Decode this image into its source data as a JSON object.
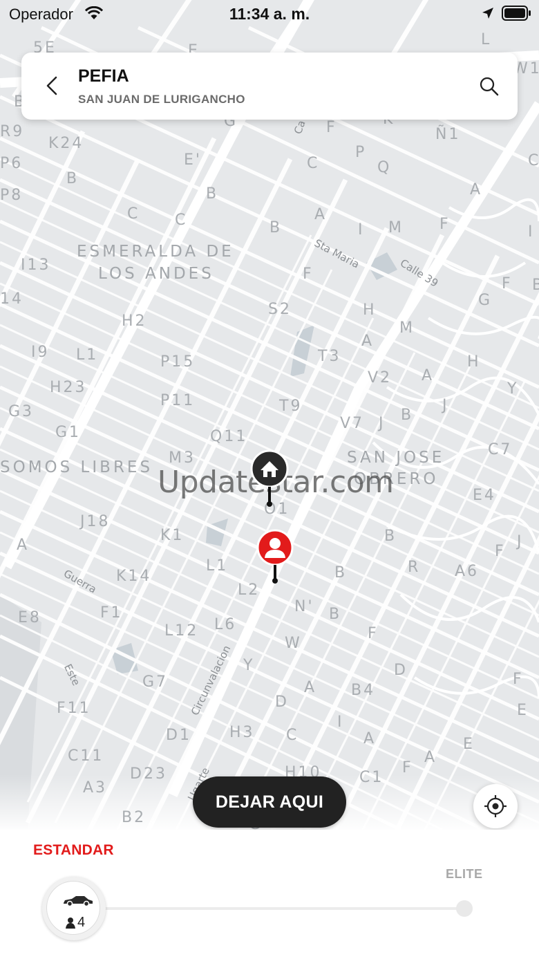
{
  "status_bar": {
    "carrier": "Operador",
    "time": "11:34 a. m."
  },
  "header": {
    "title": "PEFIA",
    "subtitle": "SAN JUAN DE LURIGANCHO"
  },
  "map": {
    "districts": [
      "ESMERALDA DE",
      "LOS ANDES",
      "SOMOS LIBRES",
      "SAN JOSE",
      "OBRERO"
    ],
    "streets": [
      "Sta Maria",
      "Calle 39",
      "Guerra",
      "Circunvalacion",
      "Este",
      "Ugarte",
      "Ca"
    ],
    "blocks": [
      "5E",
      "E",
      "R9",
      "K24",
      "P6",
      "E'",
      "B",
      "P8",
      "B",
      "C",
      "C",
      "B",
      "A",
      "I13",
      "F",
      "I",
      "M",
      "14",
      "S2",
      "H",
      "H2",
      "I9",
      "L1",
      "P15",
      "T3",
      "A",
      "H23",
      "P11",
      "T9",
      "V2",
      "A",
      "G3",
      "G1",
      "Q11",
      "V7",
      "J",
      "B",
      "M3",
      "C7",
      "O1",
      "E4",
      "J18",
      "K1",
      "B",
      "A",
      "L1",
      "B",
      "R",
      "A6",
      "K14",
      "L2",
      "N'",
      "E8",
      "F1",
      "L6",
      "B",
      "L12",
      "W",
      "F",
      "G7",
      "Y",
      "D",
      "A",
      "B4",
      "F11",
      "D",
      "E",
      "D1",
      "H3",
      "C",
      "A",
      "C11",
      "D23",
      "H10",
      "C1",
      "A3",
      "B2",
      "C",
      "P",
      "Q",
      "Ñ1",
      "K",
      "G",
      "A",
      "F",
      "G",
      "M",
      "F",
      "J",
      "Y",
      "H",
      "F",
      "J",
      "I",
      "E",
      "A",
      "F",
      "G",
      "L",
      "W1",
      "I",
      "B",
      "C",
      "B",
      "F",
      "F"
    ],
    "watermark": "Updatestar.com"
  },
  "cta": {
    "label": "DEJAR AQUI"
  },
  "icons": {
    "back": "chevron-left-icon",
    "search": "search-icon",
    "home_pin": "home-pin-icon",
    "user_pin": "user-pin-icon",
    "locate": "crosshair-icon",
    "car": "car-icon",
    "seat": "person-icon"
  },
  "colors": {
    "accent": "#e21b1b",
    "dark": "#222222",
    "map_bg": "#e6e8ea",
    "map_road": "#ffffff"
  },
  "vehicle_selector": {
    "selected_label": "ESTANDAR",
    "end_label": "ELITE",
    "seats": "4",
    "selected_fraction": 0
  }
}
